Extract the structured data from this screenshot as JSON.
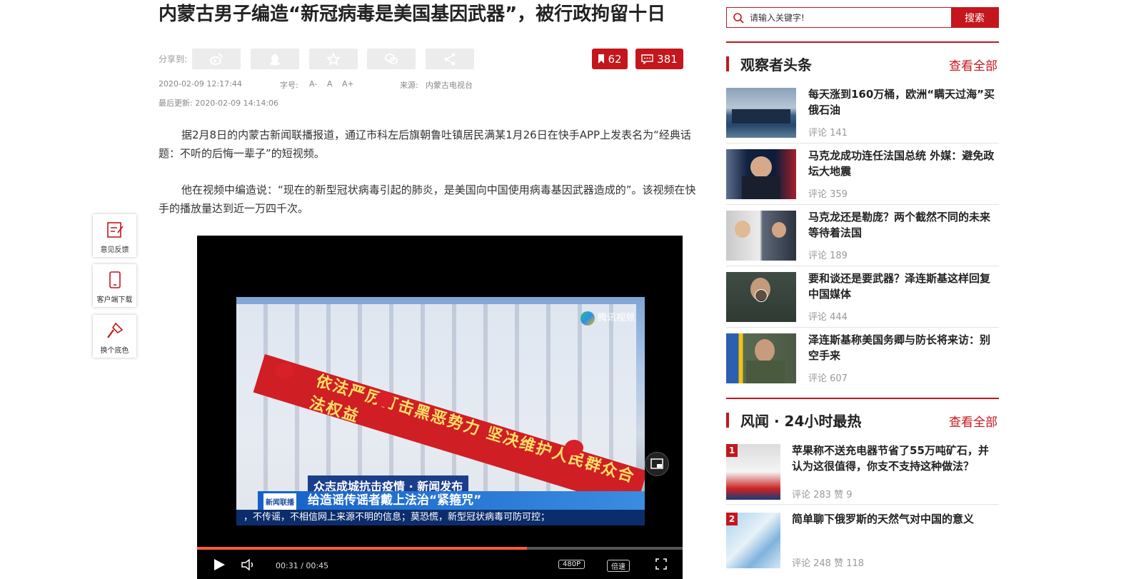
{
  "article": {
    "title": "内蒙古男子编造“新冠病毒是美国基因武器”，被行政拘留十日",
    "share_label": "分享到:",
    "share_icons": [
      "weibo-icon",
      "qq-icon",
      "star-icon",
      "wechat-icon",
      "share-icon"
    ],
    "bookmark_count": "62",
    "comment_count": "381",
    "published": "2020-02-09 12:17:44",
    "font_label": "字号:",
    "font_options": [
      "A-",
      "A",
      "A+"
    ],
    "source_label": "来源:",
    "source": "内蒙古电视台",
    "updated": "最后更新: 2020-02-09 14:14:06",
    "paragraphs": [
      "据2月8日的内蒙古新闻联播报道，通辽市科左后旗朝鲁吐镇居民满某1月26日在快手APP上发表名为“经典话题：不听的后悔一辈子”的短视频。",
      "他在视频中编造说：“现在的新型冠状病毒引起的肺炎，是美国向中国使用病毒基因武器造成的”。该视频在快手的播放量达到近一万四千次。"
    ]
  },
  "video": {
    "banner_text": "依法严厉打击黑恶势力 坚决维护人民群众合法权益",
    "tencent_label": "腾讯视频",
    "caption_top": "众志成城抗击疫情 · 新闻发布",
    "news_logo": "新闻联播",
    "caption_main": "给造谣传谣者戴上法治“紧箍咒”",
    "ticker": "，不传谣，不相信网上来源不明的信息；莫恐慌，新型冠状病毒可防可控；",
    "progress": 0.68,
    "time_current": "00:31",
    "time_total": "00:45",
    "quality": "480P",
    "speed": "倍速"
  },
  "tools": [
    {
      "label": "意见反馈",
      "icon": "feedback-icon"
    },
    {
      "label": "客户端下载",
      "icon": "phone-icon"
    },
    {
      "label": "换个底色",
      "icon": "brush-icon"
    }
  ],
  "search": {
    "placeholder": "请输入关键字!",
    "button": "搜索"
  },
  "section1": {
    "title": "观察者头条",
    "see_all": "查看全部",
    "items": [
      {
        "title": "每天涨到160万桶，欧洲“瞒天过海”买俄石油",
        "meta": "评论 141"
      },
      {
        "title": "马克龙成功连任法国总统 外媒：避免政坛大地震",
        "meta": "评论 359"
      },
      {
        "title": "马克龙还是勒庞？两个截然不同的未来等待着法国",
        "meta": "评论 189"
      },
      {
        "title": "要和谈还是要武器？泽连斯基这样回复中国媒体",
        "meta": "评论 444"
      },
      {
        "title": "泽连斯基称美国务卿与防长将来访：别空手来",
        "meta": "评论 607"
      }
    ]
  },
  "section2": {
    "title": "风闻 · 24小时最热",
    "see_all": "查看全部",
    "items": [
      {
        "rank": "1",
        "title": "苹果称不送充电器节省了55万吨矿石，并认为这很值得，你支不支持这种做法？",
        "meta": "评论 283  赞 9"
      },
      {
        "rank": "2",
        "title": "简单聊下俄罗斯的天然气对中国的意义",
        "meta": "评论 248  赞 118"
      }
    ]
  }
}
